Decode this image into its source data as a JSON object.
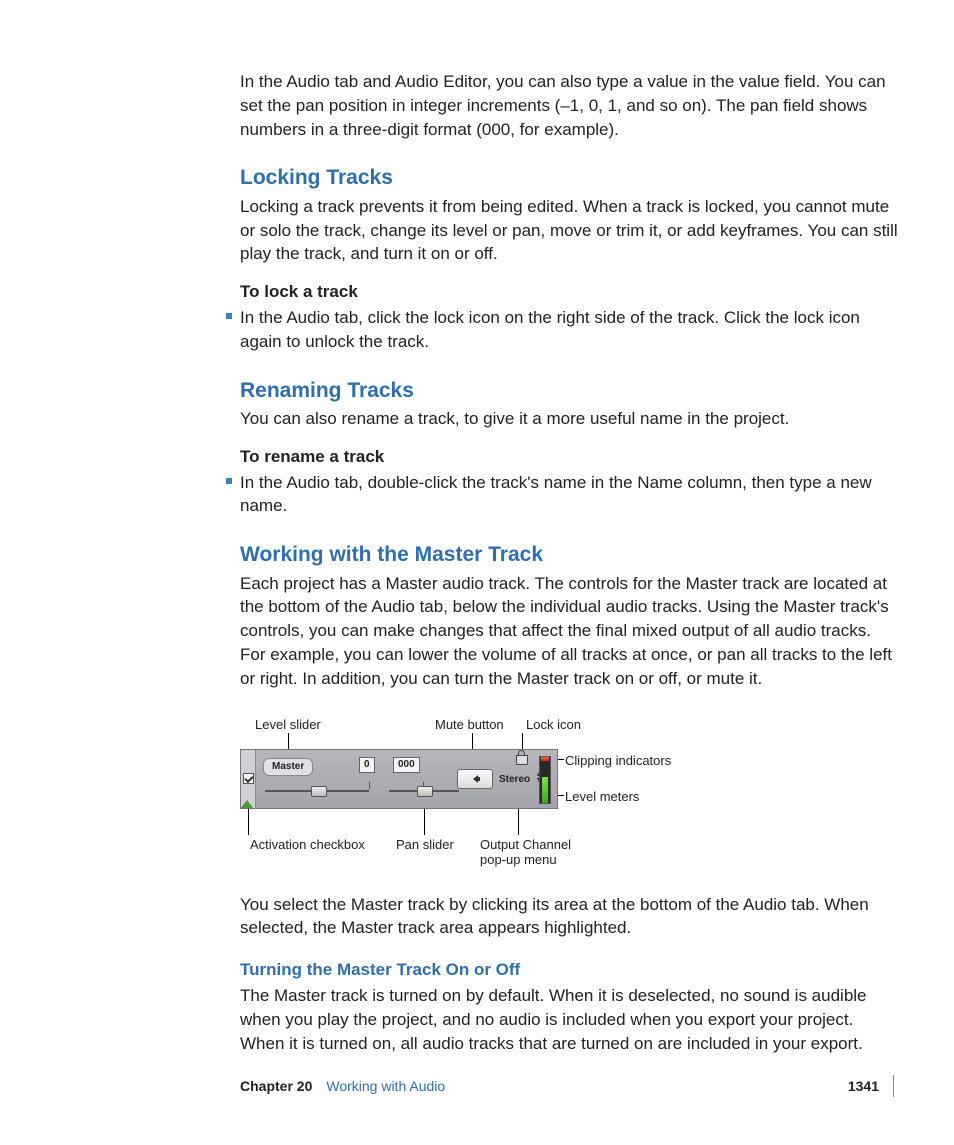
{
  "intro_para": "In the Audio tab and Audio Editor, you can also type a value in the value field. You can set the pan position in integer increments (–1, 0, 1, and so on). The pan field shows numbers in a three-digit format (000, for example).",
  "sections": {
    "locking": {
      "heading": "Locking Tracks",
      "para": "Locking a track prevents it from being edited. When a track is locked, you cannot mute or solo the track, change its level or pan, move or trim it, or add keyframes. You can still play the track, and turn it on or off.",
      "sub_heading": "To lock a track",
      "bullet": "In the Audio tab, click the lock icon on the right side of the track. Click the lock icon again to unlock the track."
    },
    "renaming": {
      "heading": "Renaming Tracks",
      "para": "You can also rename a track, to give it a more useful name in the project.",
      "sub_heading": "To rename a track",
      "bullet": "In the Audio tab, double-click the track's name in the Name column, then type a new name."
    },
    "master": {
      "heading": "Working with the Master Track",
      "para": "Each project has a Master audio track. The controls for the Master track are located at the bottom of the Audio tab, below the individual audio tracks. Using the Master track's controls, you can make changes that affect the final mixed output of all audio tracks. For example, you can lower the volume of all tracks at once, or pan all tracks to the left or right. In addition, you can turn the Master track on or off, or mute it.",
      "after_fig": "You select the Master track by clicking its area at the bottom of the Audio tab. When selected, the Master track area appears highlighted.",
      "turning_heading": "Turning the Master Track On or Off",
      "turning_para": "The Master track is turned on by default. When it is deselected, no sound is audible when you play the project, and no audio is included when you export your project. When it is turned on, all audio tracks that are turned on are included in your export."
    }
  },
  "figure": {
    "labels": {
      "level_slider": "Level slider",
      "mute_button": "Mute button",
      "lock_icon": "Lock icon",
      "clipping": "Clipping indicators",
      "level_meters": "Level meters",
      "activation": "Activation checkbox",
      "pan_slider": "Pan slider",
      "output_channel_l1": "Output Channel",
      "output_channel_l2": "pop-up menu"
    },
    "panel": {
      "master": "Master",
      "level_value": "0",
      "pan_value": "000",
      "stereo": "Stereo"
    }
  },
  "footer": {
    "chapter": "Chapter 20",
    "title": "Working with Audio",
    "page": "1341"
  }
}
